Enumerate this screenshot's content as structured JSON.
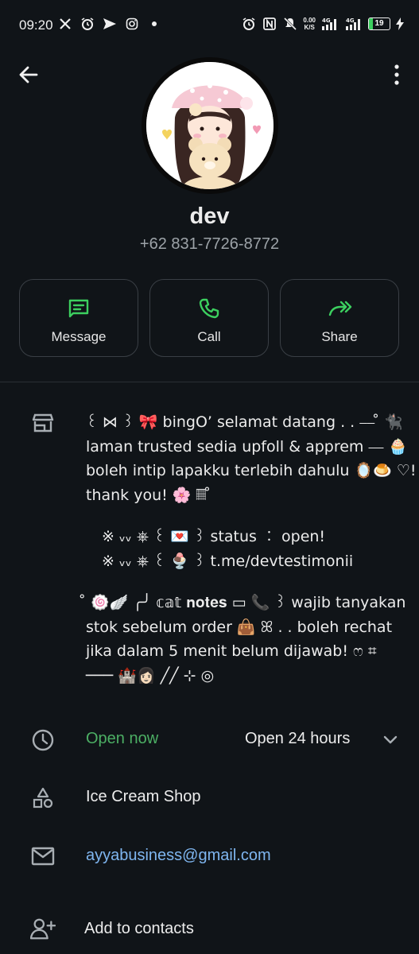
{
  "status_bar": {
    "time": "09:20",
    "net_speed_value": "0.00",
    "net_speed_unit": "K/S",
    "signal1_label": "4G",
    "signal2_label": "4G",
    "battery_percent": "19",
    "left_icons": [
      "x-icon",
      "alarm-icon",
      "send-icon",
      "instagram-icon",
      "dot-icon"
    ],
    "right_icons": [
      "alarm-icon",
      "nfc-icon",
      "mute-icon",
      "speed-readout",
      "signal-icon",
      "signal-icon",
      "battery-icon",
      "charging-icon"
    ]
  },
  "contact": {
    "name": "dev",
    "phone": "+62 831-7726-8772"
  },
  "actions": [
    {
      "label": "Message",
      "icon": "message-icon"
    },
    {
      "label": "Call",
      "icon": "phone-icon"
    },
    {
      "label": "Share",
      "icon": "share-icon"
    }
  ],
  "colors": {
    "background": "#101418",
    "accent_green": "#3ccf5f",
    "open_now": "#4caf64",
    "link_blue": "#7fb6f0"
  },
  "description": {
    "lines": [
      "꒰ ⋈ ꒱ 🎀 bingO’ selamat datang . . ⎯⎯ ̊ 🐈‍⬛",
      "laman trusted sedia upfoll & apprem ⎯⎯ 🧁",
      "boleh intip lapakku terlebih dahulu 🪞🍮 ♡!",
      "thank you! 🌸 𝄜 ̊"
    ],
    "links": [
      "※ ᵥᵥ ⎈ ꒰ 💌 ꒱  status ︰ open!",
      "※ ᵥᵥ ⎈ ꒰ 🍨 ꒱  t.me/devtestimonii"
    ],
    "notes": [
      "̊ 🍥🪽 ╭╯ 𝕔𝕒𝕥 𝐧𝐨𝐭𝐞𝐬 ▭ 📞 ꒱ wajib tanyakan",
      "stok sebelum order 👜 ꕤ . . boleh rechat",
      "jika dalam 5 menit belum dijawab! ෆ ⌗",
      "─── 🏰👩🏻 ╱╱ ⊹ ◎"
    ]
  },
  "hours": {
    "status": "Open now",
    "label": "Open 24 hours"
  },
  "category": "Ice Cream Shop",
  "email": "ayyabusiness@gmail.com",
  "add_contacts": "Add to contacts"
}
